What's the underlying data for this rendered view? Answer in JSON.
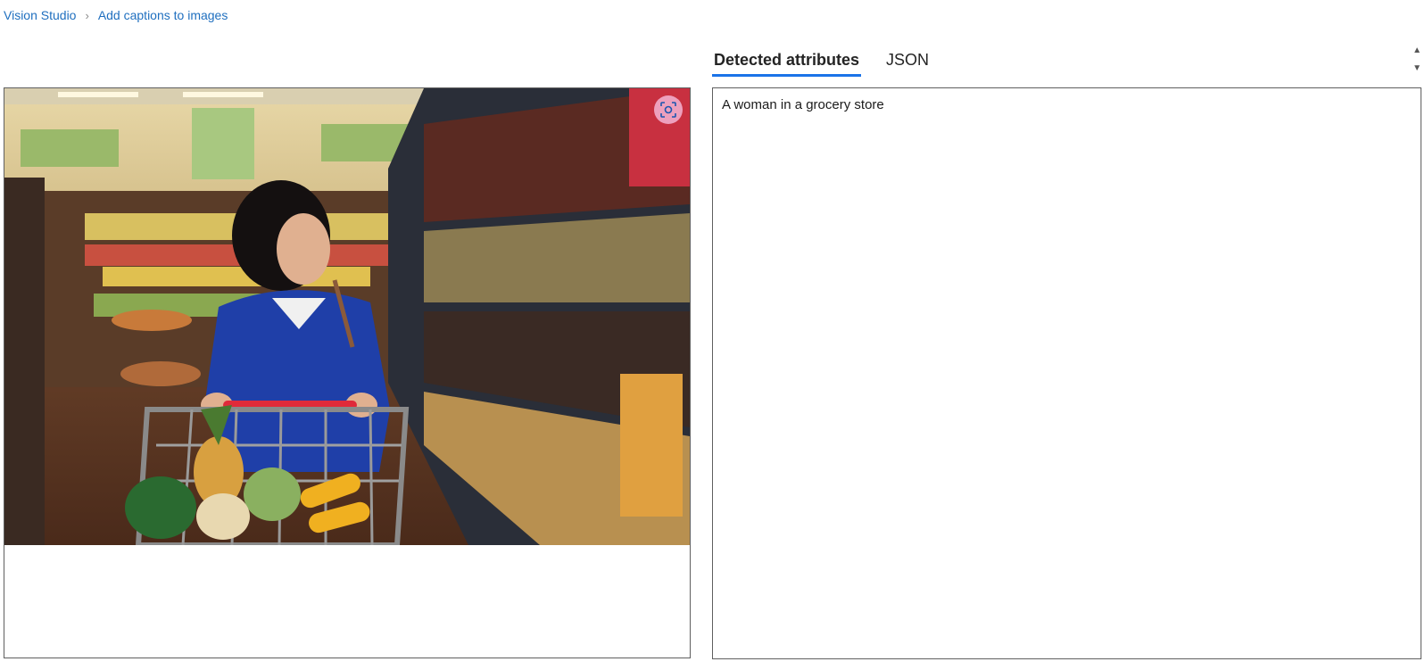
{
  "breadcrumb": {
    "root": "Vision Studio",
    "current": "Add captions to images"
  },
  "tabs": [
    {
      "label": "Detected attributes",
      "active": true
    },
    {
      "label": "JSON",
      "active": false
    }
  ],
  "results": {
    "caption": "A woman in a grocery store"
  },
  "colors": {
    "link": "#1f6fbf",
    "tab_underline": "#1a73e8",
    "panel_border": "#5f5f5f",
    "detect_button_bg": "#f0aac8"
  },
  "icons": {
    "breadcrumb_separator": "chevron-right-icon",
    "detect_button": "focus-scan-icon",
    "scroll_up": "triangle-up-icon",
    "scroll_down": "triangle-down-icon"
  }
}
